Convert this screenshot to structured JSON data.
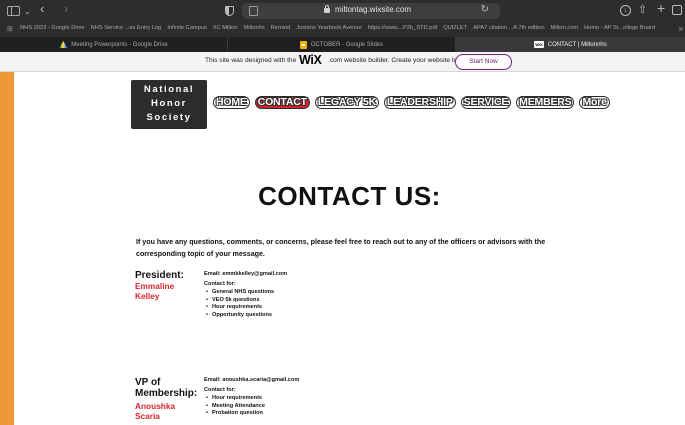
{
  "browser": {
    "url": "miltontag.wixsite.com",
    "bookmarks": [
      "NHS 2023 - Google Drive",
      "NHS Service ...es Entry Log",
      "Infinite Campus",
      "XC Milton",
      "Miltonhs",
      "Remind",
      "Jostens Yearbook Avenue",
      "https://www....P2b_STD.pdf",
      "QUIZLET",
      "APA7 citation ...A 7th edition",
      "Milton.com",
      "Home - AP St...ollege Board"
    ],
    "tabs": [
      {
        "label": "Meeting Powerpoints - Google Drive",
        "icon": "google-drive-icon"
      },
      {
        "label": "OCTOBER - Google Slides",
        "icon": "google-slides-icon"
      },
      {
        "label": "CONTACT | Miltonnhs",
        "icon": "wix-icon",
        "active": true
      }
    ]
  },
  "wix_banner": {
    "text_before": "This site was designed with the",
    "logo": "WiX",
    "text_after": ".com website builder. Create your website today.",
    "button": "Start Now"
  },
  "site": {
    "logo_lines": [
      "National",
      "Honor",
      "Society"
    ],
    "nav": [
      {
        "label": "HOME",
        "active": false
      },
      {
        "label": "CONTACT",
        "active": true
      },
      {
        "label": "LEGACY 5K",
        "active": false
      },
      {
        "label": "LEADERSHIP",
        "active": false
      },
      {
        "label": "SERVICE",
        "active": false
      },
      {
        "label": "MEMBERS",
        "active": false
      },
      {
        "label": "More",
        "active": false
      }
    ],
    "heading": "CONTACT US:",
    "intro": "If you have any questions, comments, or concerns, please feel free to reach out to any of the officers or advisors with the corresponding topic of your message."
  },
  "officers": [
    {
      "role_lines": [
        "President:"
      ],
      "name_lines": [
        "Emmaline",
        "Kelley"
      ],
      "email": "Email: emmkkelley@gmail.com",
      "contact_for": "Contact for:",
      "topics": [
        "General NHS questions",
        "VEO 5k questions",
        "Hour requirements",
        "Opportunity questions"
      ]
    },
    {
      "role_lines": [
        "VP of",
        "Membership:"
      ],
      "name_lines": [
        "Anoushka",
        "Scaria"
      ],
      "email": "Email: anoushka.scaria@gmail.com",
      "contact_for": "Contact for:",
      "topics": [
        "Hour requirements",
        "Meeting Attendance",
        "Probation question"
      ]
    }
  ],
  "colors": {
    "accent_red": "#d8232f",
    "frame_orange": "#ef9837",
    "logo_bg": "#2c2c2c"
  }
}
